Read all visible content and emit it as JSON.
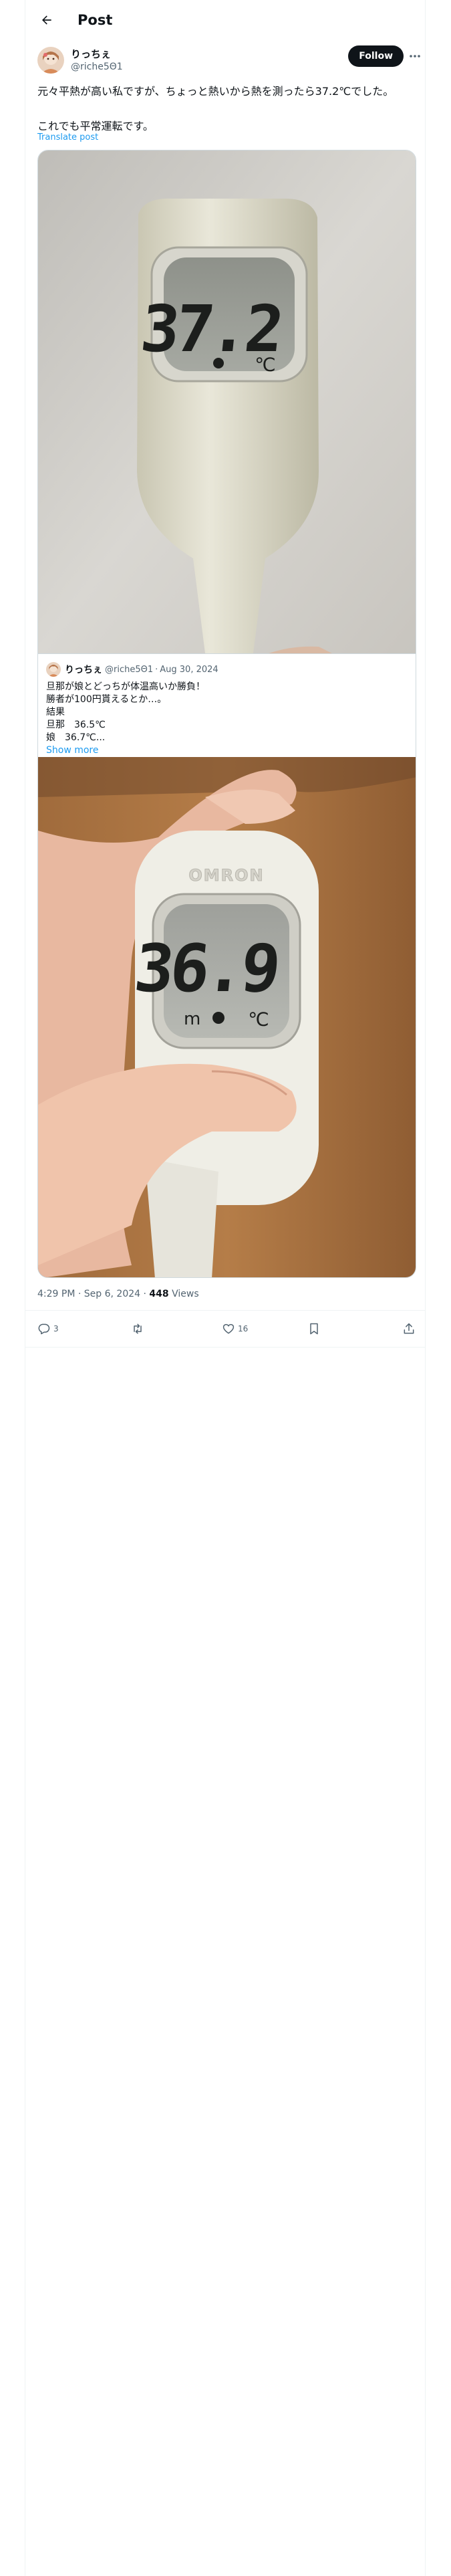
{
  "header": {
    "title": "Post",
    "back_icon": "arrow-left-icon"
  },
  "author": {
    "display_name": "りっちぇ",
    "handle": "@riche5Θ1",
    "follow_label": "Follow",
    "more_icon": "more-dots-icon"
  },
  "post": {
    "line1": "元々平熱が高い私ですが、ちょっと熱いから熱を測ったら37.2℃でした。",
    "line2": "これでも平常運転です。",
    "translate_label": "Translate post",
    "thermometer_reading": "37.2",
    "thermometer_unit": "℃"
  },
  "quote": {
    "display_name": "りっちぇ",
    "handle": "@riche5Θ1",
    "separator": "·",
    "date": "Aug 30, 2024",
    "lines": [
      "旦那が娘とどっちが体温高いか勝負！",
      "勝者が100円貰えるとか…。",
      "結果",
      "旦那　36.5℃",
      "娘　36.7℃..."
    ],
    "show_more": "Show more",
    "thermometer_brand": "OMRON",
    "thermometer_reading": "36.9",
    "thermometer_unit": "℃"
  },
  "meta": {
    "time": "4:29 PM",
    "dot": "·",
    "date": "Sep 6, 2024",
    "views_count": "448",
    "views_label": "Views"
  },
  "actions": {
    "reply_count": "3",
    "repost_count": "",
    "like_count": "16"
  },
  "colors": {
    "accent": "#1d9bf0",
    "text": "#0f1419",
    "secondary": "#536471",
    "border": "#cfd9de"
  }
}
